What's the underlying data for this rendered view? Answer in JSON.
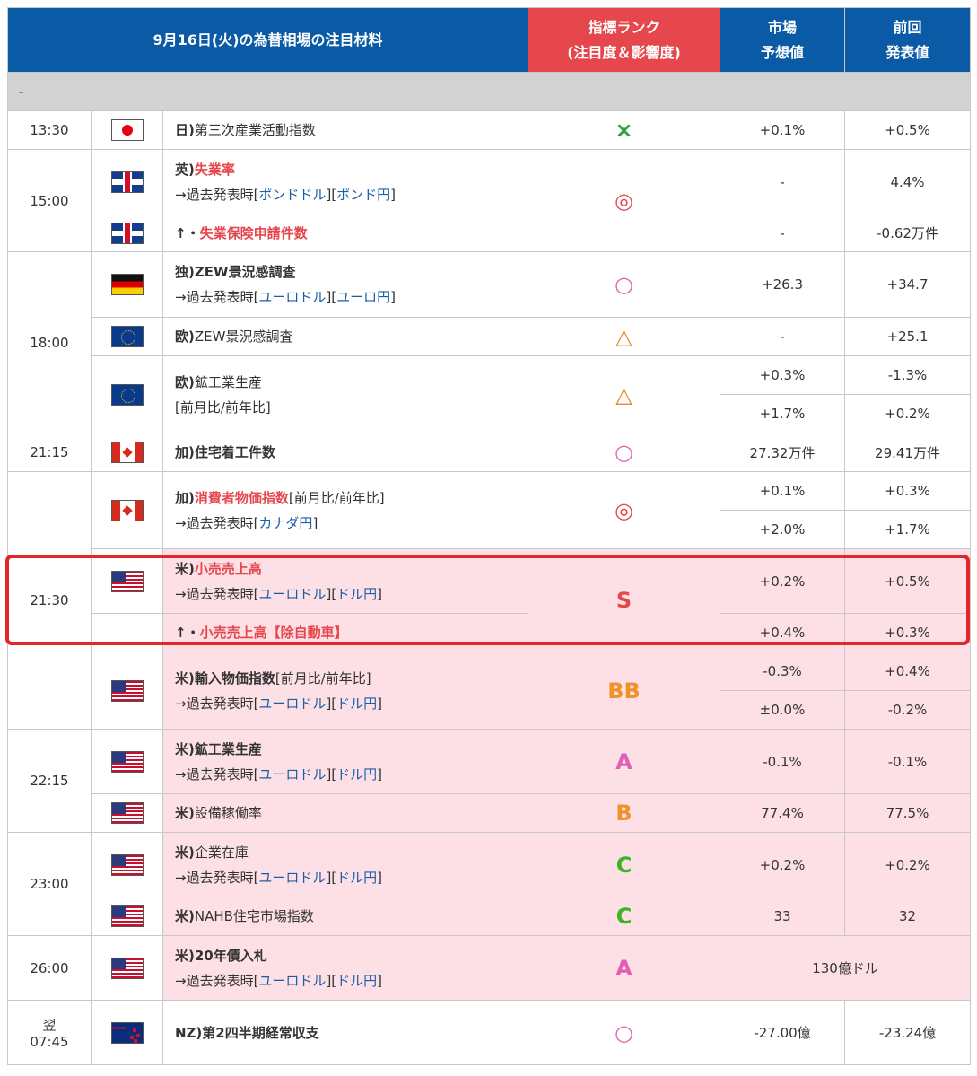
{
  "header": {
    "title": "9月16日(火)の為替相場の注目材料",
    "rank_line1": "指標ランク",
    "rank_line2": "(注目度＆影響度)",
    "forecast_line1": "市場",
    "forecast_line2": "予想値",
    "previous_line1": "前回",
    "previous_line2": "発表値"
  },
  "separator": "-",
  "colors": {
    "header": "#0a5aa6",
    "rank_header": "#e5474c",
    "pink_row": "#fde0e6",
    "highlight": "#e3262b"
  },
  "rows": {
    "r1": {
      "time": "13:30",
      "flag": "japan-flag-icon",
      "prefix": "日)",
      "name": "第三次産業活動指数",
      "rank": "×",
      "forecast": "+0.1%",
      "previous": "+0.5%"
    },
    "r2": {
      "time": "15:00",
      "flag": "uk-flag-icon",
      "prefix": "英)",
      "name": "失業率",
      "past": "→過去発表時[",
      "link1": "ポンドドル",
      "mid": "][",
      "link2": "ポンド円",
      "end": "]",
      "rank": "◎",
      "forecast": "-",
      "previous": "4.4%"
    },
    "r3": {
      "flag": "uk-flag-icon",
      "prefix": "↑・",
      "name": "失業保険申請件数",
      "forecast": "-",
      "previous": "-0.62万件"
    },
    "r4": {
      "time": "18:00",
      "flag": "germany-flag-icon",
      "prefix": "独)",
      "name": "ZEW景況感調査",
      "past": "→過去発表時[",
      "link1": "ユーロドル",
      "mid": "][",
      "link2": "ユーロ円",
      "end": "]",
      "rank": "○",
      "forecast": "+26.3",
      "previous": "+34.7"
    },
    "r5": {
      "flag": "eu-flag-icon",
      "prefix": "欧)",
      "name": "ZEW景況感調査",
      "rank": "△",
      "forecast": "-",
      "previous": "+25.1"
    },
    "r6": {
      "flag": "eu-flag-icon",
      "prefix": "欧)",
      "name": "鉱工業生産",
      "sub": "[前月比/前年比]",
      "rank": "△",
      "forecast1": "+0.3%",
      "previous1": "-1.3%",
      "forecast2": "+1.7%",
      "previous2": "+0.2%"
    },
    "r7": {
      "time": "21:15",
      "flag": "canada-flag-icon",
      "prefix": "加)",
      "name": "住宅着工件数",
      "rank": "○",
      "forecast": "27.32万件",
      "previous": "29.41万件"
    },
    "r8": {
      "flag": "canada-flag-icon",
      "prefix": "加)",
      "name": "消費者物価指数",
      "suffix": "[前月比/前年比]",
      "past": "→過去発表時[",
      "link1": "カナダ円",
      "end": "]",
      "rank": "◎",
      "forecast1": "+0.1%",
      "previous1": "+0.3%",
      "forecast2": "+2.0%",
      "previous2": "+1.7%"
    },
    "r9": {
      "time": "21:30",
      "flag": "us-flag-icon",
      "prefix": "米)",
      "name": "小売売上高",
      "past": "→過去発表時[",
      "link1": "ユーロドル",
      "mid": "][",
      "link2": "ドル円",
      "end": "]",
      "rank": "S",
      "forecast": "+0.2%",
      "previous": "+0.5%"
    },
    "r10": {
      "flag": "us-flag-icon",
      "prefix": "↑・",
      "name": "小売売上高【除自動車】",
      "forecast": "+0.4%",
      "previous": "+0.3%"
    },
    "r11": {
      "flag": "us-flag-icon",
      "prefix": "米)",
      "name": "輸入物価指数",
      "suffix": "[前月比/前年比]",
      "past": "→過去発表時[",
      "link1": "ユーロドル",
      "mid": "][",
      "link2": "ドル円",
      "end": "]",
      "rank": "BB",
      "forecast1": "-0.3%",
      "previous1": "+0.4%",
      "forecast2": "±0.0%",
      "previous2": "-0.2%"
    },
    "r12": {
      "time": "22:15",
      "flag": "us-flag-icon",
      "prefix": "米)",
      "name": "鉱工業生産",
      "past": "→過去発表時[",
      "link1": "ユーロドル",
      "mid": "][",
      "link2": "ドル円",
      "end": "]",
      "rank": "A",
      "forecast": "-0.1%",
      "previous": "-0.1%"
    },
    "r13": {
      "flag": "us-flag-icon",
      "prefix": "米)",
      "name": "設備稼働率",
      "rank": "B",
      "forecast": "77.4%",
      "previous": "77.5%"
    },
    "r14": {
      "time": "23:00",
      "flag": "us-flag-icon",
      "prefix": "米)",
      "name": "企業在庫",
      "past": "→過去発表時[",
      "link1": "ユーロドル",
      "mid": "][",
      "link2": "ドル円",
      "end": "]",
      "rank": "C",
      "forecast": "+0.2%",
      "previous": "+0.2%"
    },
    "r15": {
      "flag": "us-flag-icon",
      "prefix": "米)",
      "name": "NAHB住宅市場指数",
      "rank": "C",
      "forecast": "33",
      "previous": "32"
    },
    "r16": {
      "time": "26:00",
      "flag": "us-flag-icon",
      "prefix": "米)",
      "name": "20年債入札",
      "past": "→過去発表時[",
      "link1": "ユーロドル",
      "mid": "][",
      "link2": "ドル円",
      "end": "]",
      "rank": "A",
      "merged": "130億ドル"
    },
    "r17": {
      "time_line1": "翌",
      "time_line2": "07:45",
      "flag": "new-zealand-flag-icon",
      "prefix": "NZ)",
      "name": "第2四半期経常収支",
      "rank": "○",
      "forecast": "-27.00億",
      "previous": "-23.24億"
    }
  }
}
